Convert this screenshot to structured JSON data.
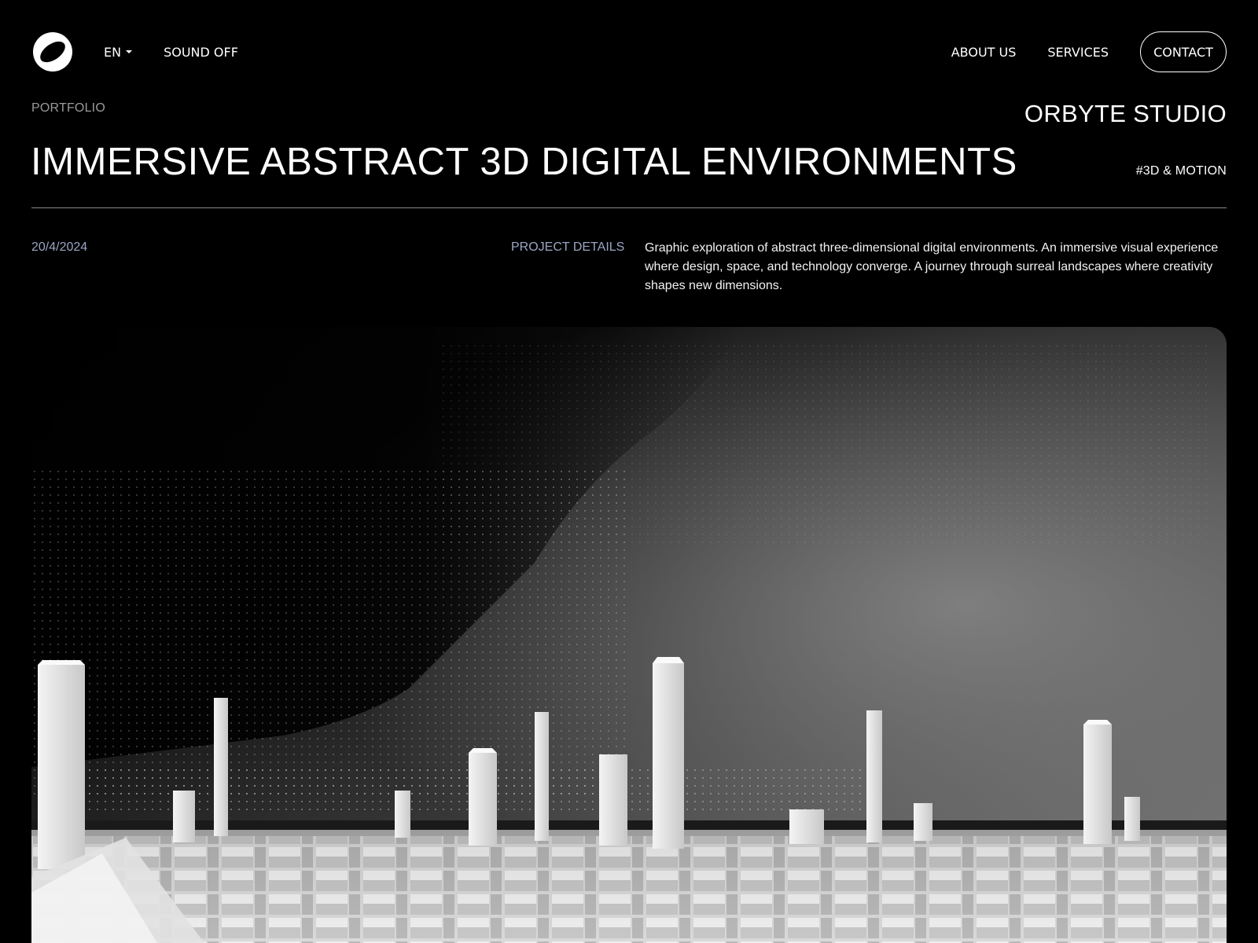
{
  "header": {
    "language": "EN",
    "sound_toggle": "SOUND OFF",
    "nav": [
      {
        "label": "ABOUT US"
      },
      {
        "label": "SERVICES"
      }
    ],
    "contact_label": "CONTACT"
  },
  "project": {
    "breadcrumb": "PORTFOLIO",
    "studio": "ORBYTE STUDIO",
    "title": "IMMERSIVE ABSTRACT 3D DIGITAL ENVIRONMENTS",
    "tag": "#3D & MOTION",
    "date": "20/4/2024",
    "details_label": "PROJECT DETAILS",
    "description": "Graphic exploration of abstract three-dimensional digital environments. An immersive visual experience where design, space, and technology converge. A journey through surreal landscapes where creativity shapes new dimensions."
  },
  "icons": {
    "logo": "orbit-logo-icon",
    "language_caret": "caret-down-icon"
  },
  "colors": {
    "background": "#000000",
    "text": "#ffffff",
    "muted": "#9a9a9a",
    "accent_muted": "#9aa6c4"
  }
}
